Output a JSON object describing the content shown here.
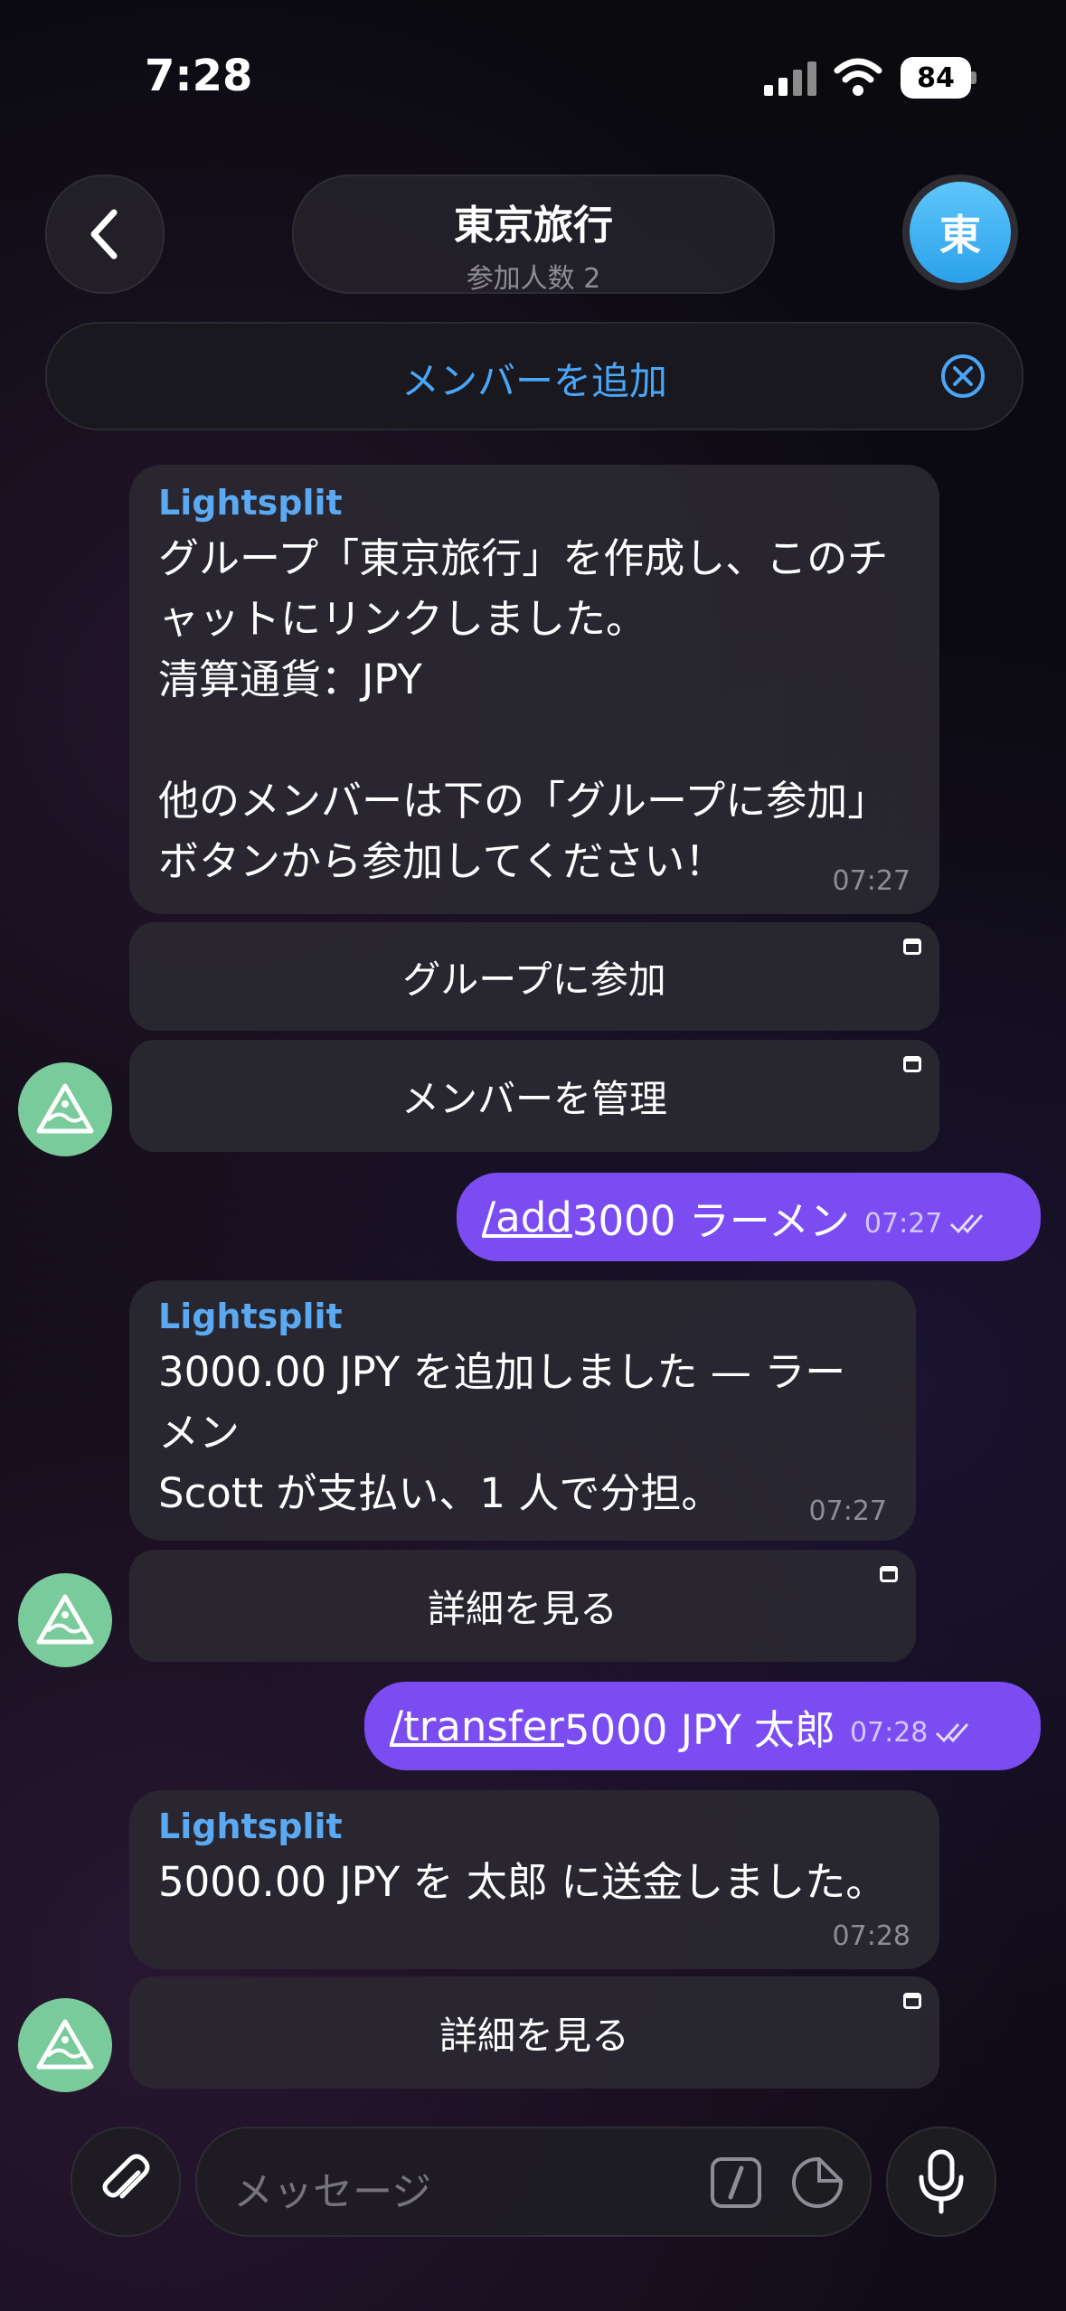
{
  "status_bar": {
    "time": "7:28",
    "battery": "84"
  },
  "header": {
    "title": "東京旅行",
    "subtitle": "参加人数 2",
    "avatar_letter": "東"
  },
  "banner": {
    "label": "メンバーを追加"
  },
  "messages": {
    "m1": {
      "sender": "Lightsplit",
      "line1": "グループ「東京旅行」を作成し、このチ",
      "line2": "ャットにリンクしました。",
      "line3": "清算通貨：JPY",
      "line4": "他のメンバーは下の「グループに参加」",
      "line5": "ボタンから参加してください！",
      "time": "07:27",
      "btn1": "グループに参加",
      "btn2": "メンバーを管理"
    },
    "o1": {
      "command": "/add",
      "text": " 3000 ラーメン",
      "time": "07:27"
    },
    "m2": {
      "sender": "Lightsplit",
      "line1": "3000.00 JPY を追加しました — ラー",
      "line2": "メン",
      "line3": "Scott が支払い、1 人で分担。",
      "time": "07:27",
      "btn1": "詳細を見る"
    },
    "o2": {
      "command": "/transfer",
      "text": " 5000 JPY 太郎",
      "time": "07:28"
    },
    "m3": {
      "sender": "Lightsplit",
      "line1": "5000.00 JPY を 太郎 に送金しました。",
      "time": "07:28",
      "btn1": "詳細を見る"
    }
  },
  "input": {
    "placeholder": "メッセージ"
  },
  "icons": {
    "back": "chevron-left-icon",
    "close": "close-circle-icon",
    "attach": "paperclip-icon",
    "commands": "slash-command-icon",
    "sticker": "sticker-icon",
    "mic": "microphone-icon",
    "bot": "lightsplit-logo-icon"
  },
  "colors": {
    "accent_blue": "#4aa6f7",
    "outgoing": "#7b4cf2",
    "bot_avatar": "#7acb9c"
  }
}
